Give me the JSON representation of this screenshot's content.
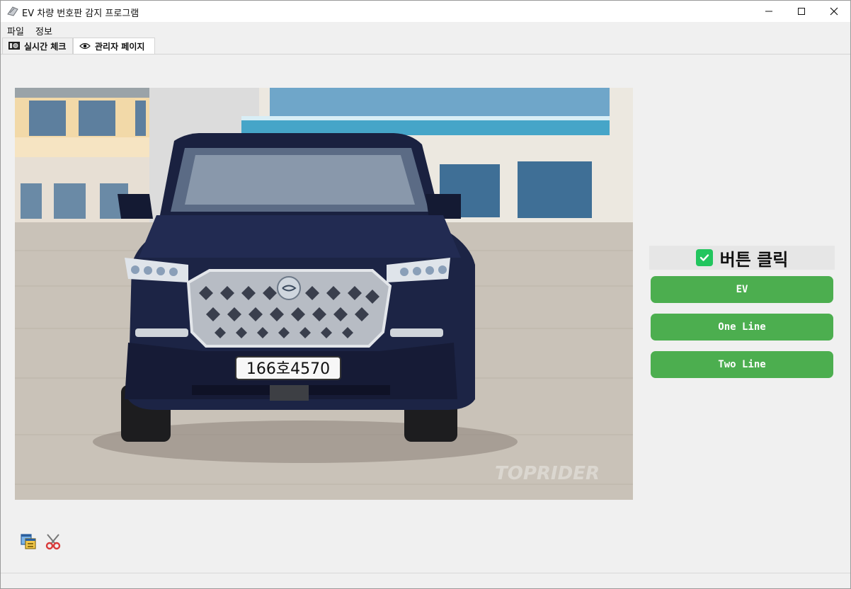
{
  "window": {
    "title": "EV 차량 번호판 감지 프로그램",
    "minimize_icon": "minimize-icon",
    "maximize_icon": "maximize-icon",
    "close_icon": "close-icon"
  },
  "menu": {
    "items": [
      {
        "label": "파일"
      },
      {
        "label": "정보"
      }
    ]
  },
  "tabs": [
    {
      "label": "실시간 체크",
      "icon": "camera-icon",
      "active": false
    },
    {
      "label": "관리자 페이지",
      "icon": "eye-icon",
      "active": true
    }
  ],
  "main": {
    "image": {
      "plate_text": "166호4570",
      "watermark": "TOPRIDER"
    },
    "check": {
      "label": "버튼 클릭",
      "checked": true,
      "color": "#22c55e"
    },
    "buttons": [
      {
        "label": "EV"
      },
      {
        "label": "One Line"
      },
      {
        "label": "Two Line"
      }
    ],
    "button_color": "#4cae4f"
  },
  "toolbar": {
    "icons": [
      "copy-window-icon",
      "scissors-icon"
    ]
  }
}
